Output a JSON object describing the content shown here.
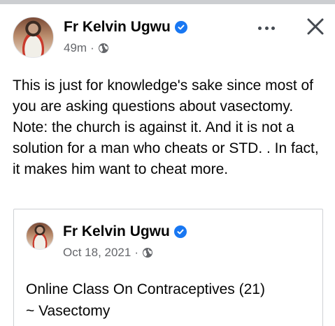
{
  "post": {
    "author": "Fr Kelvin Ugwu",
    "time": "49m",
    "separator": "·",
    "body": "This is just for knowledge's sake since most of you are asking questions about vasectomy. Note: the church is against it. And it is not a solution for a man who cheats or STD. . In fact, it makes him want to cheat more."
  },
  "shared": {
    "author": "Fr Kelvin Ugwu",
    "date": "Oct 18, 2021",
    "separator": "·",
    "body_line1": "Online Class On Contraceptives (21)",
    "body_line2": "~ Vasectomy"
  },
  "icons": {
    "verified": "verified-check-icon",
    "audience": "globe-icon",
    "more": "more-options-icon",
    "close": "close-icon"
  },
  "colors": {
    "verified_blue": "#1877f2",
    "meta_gray": "#65676b",
    "text": "#050505"
  }
}
